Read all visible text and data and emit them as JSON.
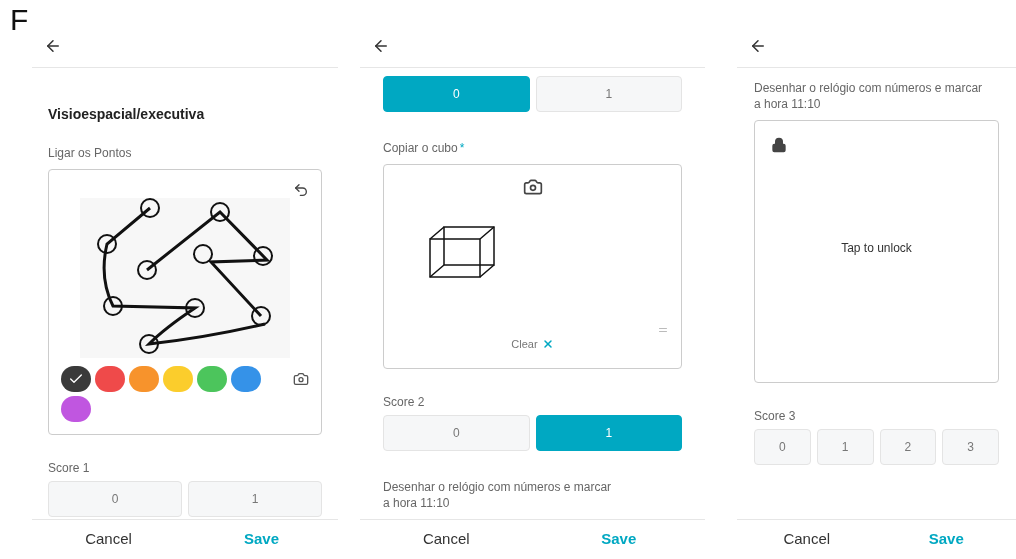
{
  "figure_label": "F",
  "panels": [
    {
      "blocks": [
        {
          "kind": "heading",
          "text": "Visioespacial/executiva"
        },
        {
          "kind": "label",
          "text": "Ligar os Pontos"
        },
        {
          "kind": "drawing_pad",
          "swatches": [
            {
              "color": "#3a3a3a",
              "selected": true
            },
            {
              "color": "#ef4a4a",
              "selected": false
            },
            {
              "color": "#f7932c",
              "selected": false
            },
            {
              "color": "#fbcd2c",
              "selected": false
            },
            {
              "color": "#4cc55c",
              "selected": false
            },
            {
              "color": "#3592e8",
              "selected": false
            },
            {
              "color": "#c056e0",
              "selected": false
            }
          ]
        },
        {
          "kind": "score",
          "label": "Score 1",
          "options": [
            {
              "label": "0",
              "selected": false
            },
            {
              "label": "1",
              "selected": false
            }
          ]
        }
      ],
      "footer": {
        "cancel": "Cancel",
        "save": "Save"
      }
    },
    {
      "blocks": [
        {
          "kind": "score",
          "options": [
            {
              "label": "0",
              "selected": true
            },
            {
              "label": "1",
              "selected": false
            }
          ]
        },
        {
          "kind": "label",
          "text": "Copiar o cubo",
          "required_mark": "*"
        },
        {
          "kind": "photo_pad",
          "clear": "Clear"
        },
        {
          "kind": "score",
          "label": "Score 2",
          "options": [
            {
              "label": "0",
              "selected": false
            },
            {
              "label": "1",
              "selected": true
            }
          ]
        },
        {
          "kind": "label",
          "text": "Desenhar o relógio com números e marcar a hora 11:10"
        }
      ],
      "footer": {
        "cancel": "Cancel",
        "save": "Save"
      }
    },
    {
      "blocks": [
        {
          "kind": "label",
          "text": "Desenhar o relógio com números e marcar a hora 11:10"
        },
        {
          "kind": "locked_pad",
          "hint": "Tap to unlock"
        },
        {
          "kind": "score",
          "label": "Score 3",
          "options": [
            {
              "label": "0",
              "selected": false
            },
            {
              "label": "1",
              "selected": false
            },
            {
              "label": "2",
              "selected": false
            },
            {
              "label": "3",
              "selected": false
            }
          ]
        }
      ],
      "footer": {
        "cancel": "Cancel",
        "save": "Save"
      }
    }
  ]
}
